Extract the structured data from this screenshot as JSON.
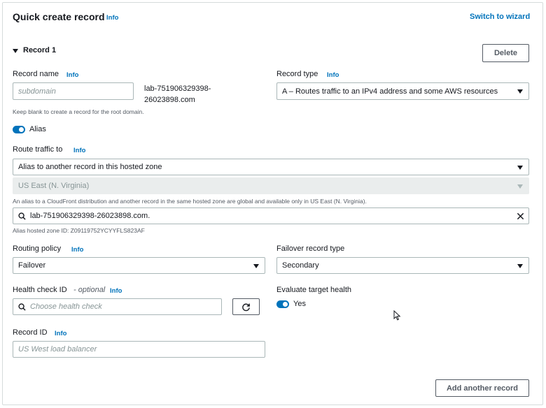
{
  "header": {
    "title": "Quick create record",
    "info": "Info",
    "switch_wizard": "Switch to wizard"
  },
  "record": {
    "section_label": "Record 1",
    "delete_label": "Delete"
  },
  "record_name": {
    "label": "Record name",
    "info": "Info",
    "placeholder": "subdomain",
    "domain_suffix_line1": "lab-751906329398-",
    "domain_suffix_line2": "26023898.com",
    "hint": "Keep blank to create a record for the root domain."
  },
  "record_type": {
    "label": "Record type",
    "info": "Info",
    "value": "A – Routes traffic to an IPv4 address and some AWS resources"
  },
  "alias": {
    "label": "Alias",
    "enabled": true
  },
  "route_traffic": {
    "label": "Route traffic to",
    "info": "Info",
    "target_value": "Alias to another record in this hosted zone",
    "region_value": "US East (N. Virginia)",
    "hint": "An alias to a CloudFront distribution and another record in the same hosted zone are global and available only in US East (N. Virginia).",
    "search_value": "lab-751906329398-26023898.com.",
    "hosted_zone_id": "Alias hosted zone ID: Z09119752YCYYFLS823AF"
  },
  "routing_policy": {
    "label": "Routing policy",
    "info": "Info",
    "value": "Failover"
  },
  "failover_type": {
    "label": "Failover record type",
    "value": "Secondary"
  },
  "health_check": {
    "label": "Health check ID",
    "optional": "- optional",
    "info": "Info",
    "placeholder": "Choose health check"
  },
  "evaluate_health": {
    "label": "Evaluate target health",
    "toggle_label": "Yes",
    "enabled": true
  },
  "record_id": {
    "label": "Record ID",
    "info": "Info",
    "placeholder": "US West load balancer"
  },
  "footer": {
    "add_another_label": "Add another record"
  },
  "colors": {
    "accent": "#0073bb",
    "border": "#aab7b8",
    "disabled_bg": "#eaeded"
  }
}
